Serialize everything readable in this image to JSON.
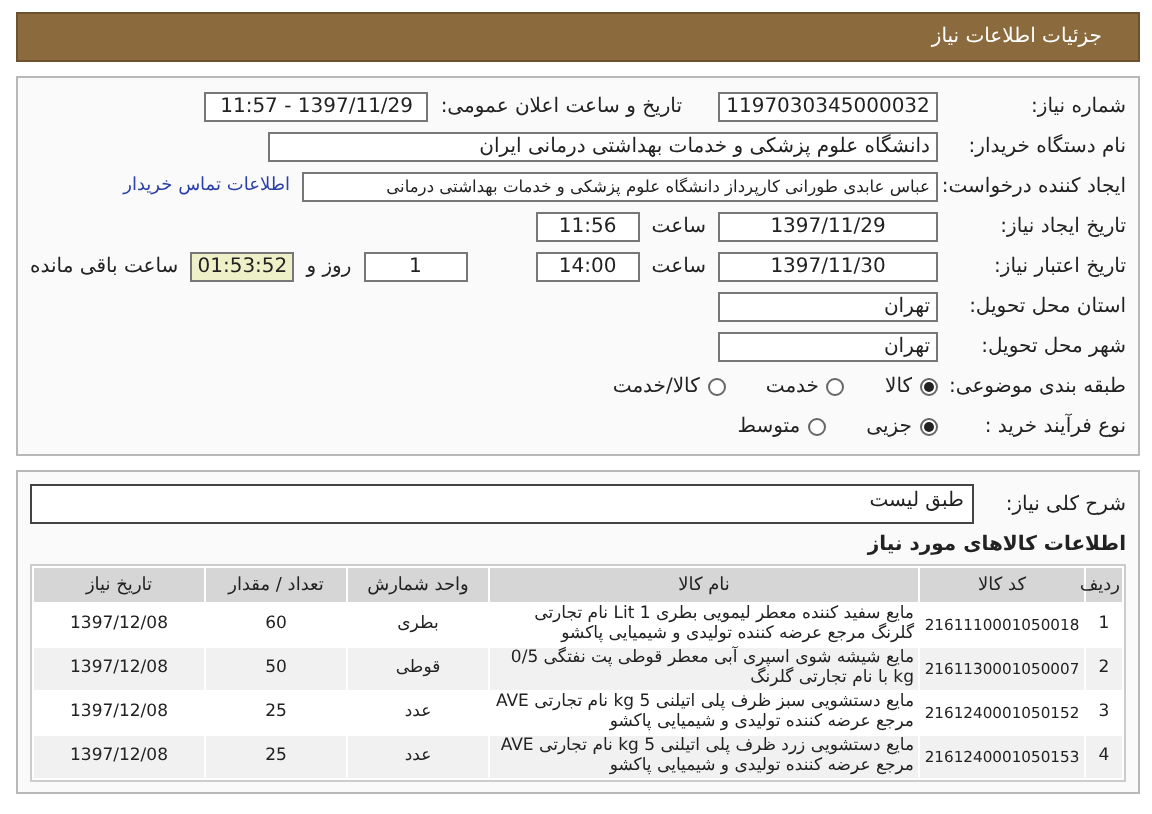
{
  "title": "جزئیات اطلاعات نیاز",
  "need_number": {
    "label": "شماره نیاز:",
    "value": "1197030345000032"
  },
  "announce": {
    "label": "تاریخ و ساعت اعلان عمومی:",
    "value": "1397/11/29 - 11:57"
  },
  "buyer": {
    "label": "نام دستگاه خریدار:",
    "value": "دانشگاه علوم پزشکی و خدمات بهداشتی درمانی ایران"
  },
  "requester": {
    "label": "ایجاد کننده درخواست:",
    "value": "عباس عابدی طورانی کارپرداز دانشگاه علوم پزشکی و خدمات بهداشتی درمانی",
    "link": "اطلاعات تماس خریدار"
  },
  "created": {
    "label": "تاریخ ایجاد نیاز:",
    "date": "1397/11/29",
    "time_label": "ساعت",
    "time": "11:56"
  },
  "validity": {
    "label": "تاریخ اعتبار نیاز:",
    "date": "1397/11/30",
    "time_label": "ساعت",
    "time": "14:00",
    "days": "1",
    "days_label": "روز و",
    "remaining": "01:53:52",
    "remaining_label": "ساعت باقی مانده"
  },
  "province": {
    "label": "استان محل تحویل:",
    "value": "تهران"
  },
  "city": {
    "label": "شهر محل تحویل:",
    "value": "تهران"
  },
  "category": {
    "label": "طبقه بندی موضوعی:",
    "options": [
      {
        "label": "کالا",
        "selected": true
      },
      {
        "label": "خدمت",
        "selected": false
      },
      {
        "label": "کالا/خدمت",
        "selected": false
      }
    ]
  },
  "process": {
    "label": "نوع فرآیند خرید :",
    "options": [
      {
        "label": "جزیی",
        "selected": true
      },
      {
        "label": "متوسط",
        "selected": false
      }
    ]
  },
  "description": {
    "label": "شرح کلی نیاز:",
    "value": "طبق لیست"
  },
  "items_heading": "اطلاعات کالاهای مورد نیاز",
  "table": {
    "columns": [
      "ردیف",
      "کد کالا",
      "نام کالا",
      "واحد شمارش",
      "تعداد / مقدار",
      "تاریخ نیاز"
    ],
    "rows": [
      [
        "1",
        "2161110001050018",
        "مایع سفید کننده معطر لیمویی بطری 1 Lit نام تجارتی گلرنگ مرجع عرضه کننده تولیدی و شیمیایی پاکشو",
        "بطری",
        "60",
        "1397/12/08"
      ],
      [
        "2",
        "2161130001050007",
        "مایع شیشه شوی اسپری آبی معطر قوطی پت نفتگی 0/5 kg با نام تجارتی گلرنگ",
        "قوطی",
        "50",
        "1397/12/08"
      ],
      [
        "3",
        "2161240001050152",
        "مایع دستشویی سبز ظرف پلی اتیلنی 5 kg نام تجارتی AVE مرجع عرضه کننده تولیدی و شیمیایی پاکشو",
        "عدد",
        "25",
        "1397/12/08"
      ],
      [
        "4",
        "2161240001050153",
        "مایع دستشویی زرد ظرف پلی اتیلنی 5 kg نام تجارتی AVE مرجع عرضه کننده تولیدی و شیمیایی پاکشو",
        "عدد",
        "25",
        "1397/12/08"
      ]
    ]
  }
}
